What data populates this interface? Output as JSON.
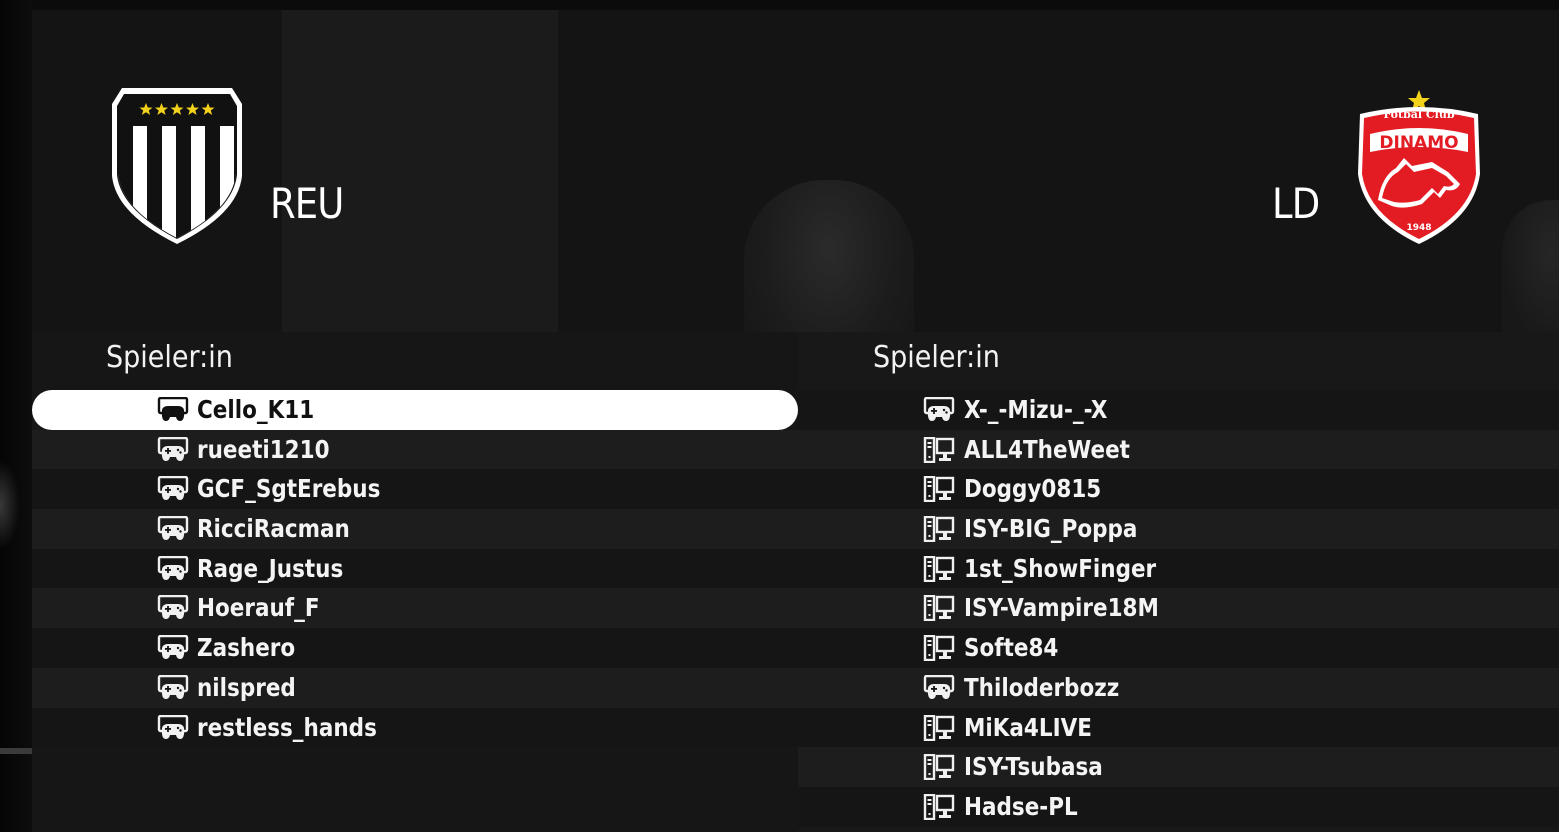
{
  "match": {
    "home": {
      "name": "REU",
      "logo_icon": "black-white-striped-shield-with-five-stars",
      "colors": {
        "primary": "#000000",
        "secondary": "#ffffff",
        "stars": "#f3d21b"
      }
    },
    "away": {
      "name": "LD",
      "logo_icon": "dinamo-bucuresti-crest",
      "logo_text": "Fotbal Club DINAMO",
      "logo_year": "1948",
      "colors": {
        "primary": "#e31b23",
        "secondary": "#ffffff",
        "star": "#f3d21b"
      }
    }
  },
  "rosters": {
    "home": {
      "title": "Spieler:in",
      "players": [
        {
          "name": "Cello_K11",
          "device": "gamepad-icon",
          "selected": true
        },
        {
          "name": "rueeti1210",
          "device": "gamepad-icon",
          "selected": false
        },
        {
          "name": "GCF_SgtErebus",
          "device": "gamepad-icon",
          "selected": false
        },
        {
          "name": "RicciRacman",
          "device": "gamepad-icon",
          "selected": false
        },
        {
          "name": "Rage_Justus",
          "device": "gamepad-icon",
          "selected": false
        },
        {
          "name": "Hoerauf_F",
          "device": "gamepad-icon",
          "selected": false
        },
        {
          "name": "Zashero",
          "device": "gamepad-icon",
          "selected": false
        },
        {
          "name": "nilspred",
          "device": "gamepad-icon",
          "selected": false
        },
        {
          "name": "restless_hands",
          "device": "gamepad-icon",
          "selected": false
        }
      ]
    },
    "away": {
      "title": "Spieler:in",
      "players": [
        {
          "name": "X-_-Mizu-_-X",
          "device": "gamepad-icon"
        },
        {
          "name": "ALL4TheWeet",
          "device": "pc-icon"
        },
        {
          "name": "Doggy0815",
          "device": "pc-icon"
        },
        {
          "name": "ISY-BIG_Poppa",
          "device": "pc-icon"
        },
        {
          "name": "1st_ShowFinger",
          "device": "pc-icon"
        },
        {
          "name": "ISY-Vampire18M",
          "device": "pc-icon"
        },
        {
          "name": "Softe84",
          "device": "pc-icon"
        },
        {
          "name": "Thiloderbozz",
          "device": "gamepad-icon"
        },
        {
          "name": "MiKa4LIVE",
          "device": "pc-icon"
        },
        {
          "name": "ISY-Tsubasa",
          "device": "pc-icon"
        },
        {
          "name": "Hadse-PL",
          "device": "pc-icon"
        }
      ]
    }
  },
  "theme": {
    "text": "#ffffff",
    "selected_bg": "#ffffff",
    "selected_text": "#111111"
  }
}
